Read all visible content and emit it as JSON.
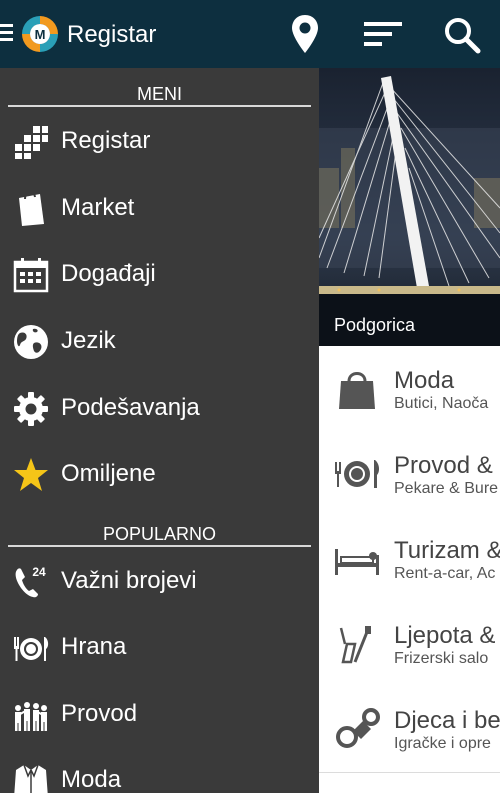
{
  "header": {
    "title": "Registar",
    "logo_letter": "M"
  },
  "drawer": {
    "section_menu": "MENI",
    "menu_items": [
      {
        "label": "Registar",
        "icon": "grid-icon"
      },
      {
        "label": "Market",
        "icon": "shopping-bag-icon"
      },
      {
        "label": "Događaji",
        "icon": "calendar-icon"
      },
      {
        "label": "Jezik",
        "icon": "globe-icon"
      },
      {
        "label": "Podešavanja",
        "icon": "gear-icon"
      },
      {
        "label": "Omiljene",
        "icon": "star-icon"
      }
    ],
    "section_popular": "POPULARNO",
    "popular_items": [
      {
        "label": "Važni brojevi",
        "icon": "phone-24-icon",
        "badge": "24"
      },
      {
        "label": "Hrana",
        "icon": "plate-cutlery-icon"
      },
      {
        "label": "Provod",
        "icon": "people-icon"
      },
      {
        "label": "Moda",
        "icon": "jacket-icon"
      }
    ]
  },
  "hero": {
    "caption": "Podgorica"
  },
  "categories": [
    {
      "title": "Moda",
      "subtitle": "Butici, Naoča"
    },
    {
      "title": "Provod & I",
      "subtitle": "Pekare & Bure"
    },
    {
      "title": "Turizam &",
      "subtitle": "Rent-a-car, Ac"
    },
    {
      "title": "Ljepota &",
      "subtitle": "Frizerski salo"
    },
    {
      "title": "Djeca i be",
      "subtitle": "Igračke i opre"
    }
  ],
  "colors": {
    "topbar": "#0d2f3f",
    "drawer": "#3a3a3a",
    "accent_star": "#f5c518",
    "logo_orange": "#f29a1f",
    "logo_teal": "#2a9fb7"
  }
}
